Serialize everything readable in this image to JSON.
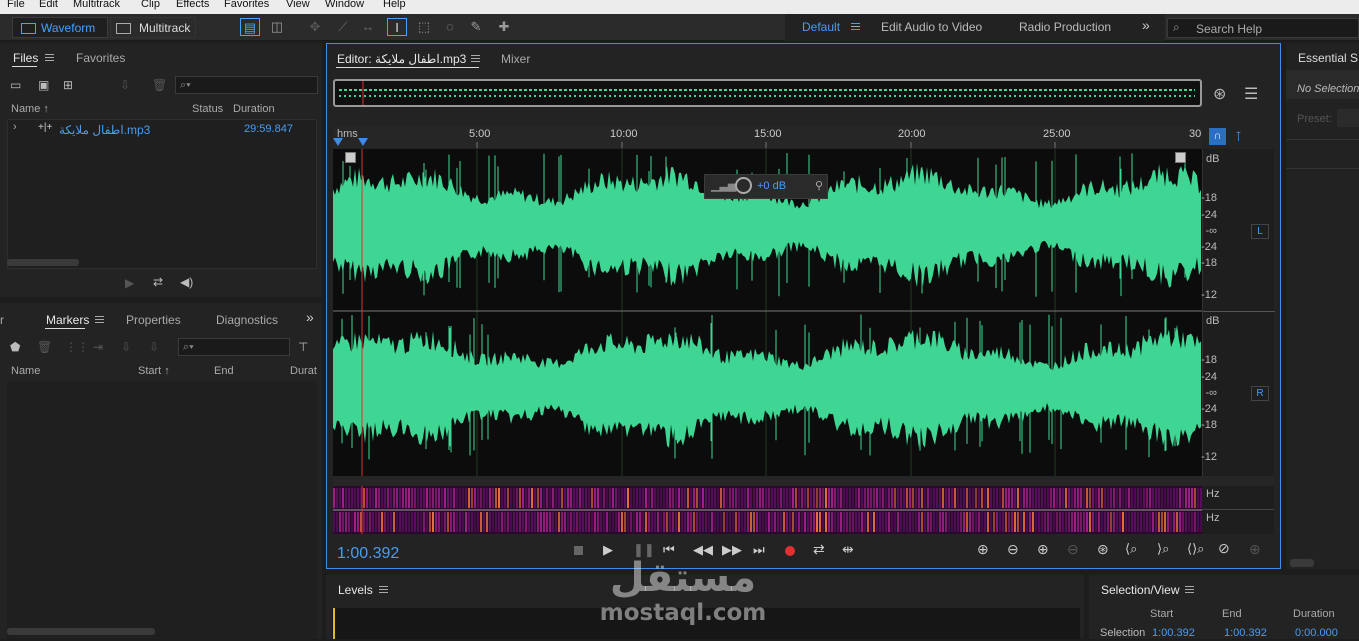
{
  "menu": [
    "File",
    "Edit",
    "Multitrack",
    "Clip",
    "Effects",
    "Favorites",
    "View",
    "Window",
    "Help"
  ],
  "toolbar": {
    "waveform": "Waveform",
    "multitrack": "Multitrack",
    "workspace_default": "Default",
    "workspace_edit_video": "Edit Audio to Video",
    "workspace_radio": "Radio Production",
    "more": "»",
    "search_placeholder": "Search Help"
  },
  "files": {
    "tab_files": "Files",
    "tab_favorites": "Favorites",
    "col_name": "Name ↑",
    "col_status": "Status",
    "col_duration": "Duration",
    "item_name": "اطفال ملايكة.mp3",
    "item_duration": "29:59.847"
  },
  "markers": {
    "tab_prev": "r",
    "tab_markers": "Markers",
    "tab_properties": "Properties",
    "tab_diagnostics": "Diagnostics",
    "more": "»",
    "col_name": "Name",
    "col_start": "Start ↑",
    "col_end": "End",
    "col_dur": "Durat"
  },
  "editor": {
    "tab_editor": "Editor: اطفال ملايكة.mp3",
    "tab_mixer": "Mixer",
    "ruler_hms": "hms",
    "ruler": [
      "5:00",
      "10:00",
      "15:00",
      "20:00",
      "25:00",
      "30"
    ],
    "hud_db": "+0 dB",
    "db_label": "dB",
    "scale_top": [
      "-18",
      "-24",
      "-∞",
      "-24",
      "-18",
      "-12"
    ],
    "channel_L": "L",
    "channel_R": "R",
    "hz": "Hz",
    "time_display": "1:00.392"
  },
  "essential": {
    "title": "Essential S",
    "no_selection": "No Selection",
    "preset": "Preset:"
  },
  "levels": {
    "title": "Levels"
  },
  "selection_view": {
    "title": "Selection/View",
    "col_start": "Start",
    "col_end": "End",
    "col_duration": "Duration",
    "row_label": "Selection",
    "start": "1:00.392",
    "end": "1:00.392",
    "duration": "0:00.000"
  },
  "watermark": {
    "arabic": "مستقل",
    "latin": "mostaql.com"
  },
  "colors": {
    "accent": "#3a8ee6",
    "waveform": "#3fd693",
    "playhead": "#e03030",
    "record": "#e03030"
  }
}
